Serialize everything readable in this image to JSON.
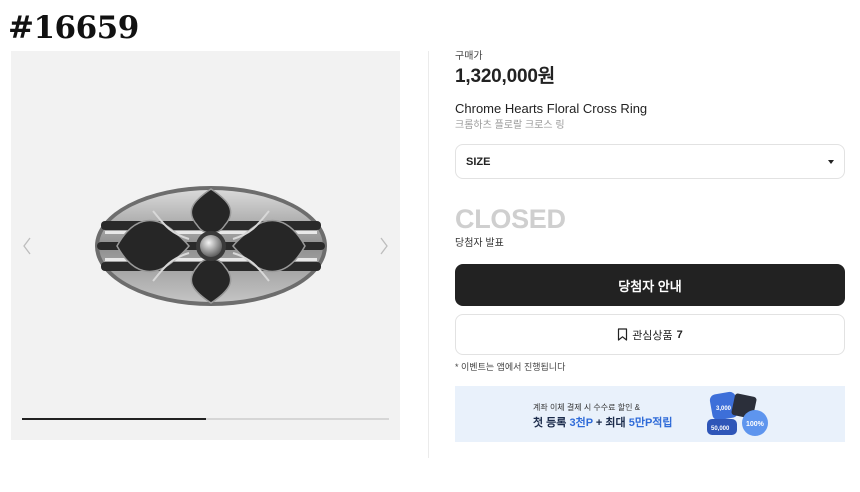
{
  "listing_tag": "#16659",
  "gallery": {
    "image_alt": "Chrome Hearts Floral Cross Ring",
    "progress_fraction": 0.5,
    "prev_icon": "chevron-left-icon",
    "next_icon": "chevron-right-icon"
  },
  "product": {
    "price_label": "구매가",
    "price": "1,320,000원",
    "name_en": "Chrome Hearts Floral Cross Ring",
    "name_ko": "크롬하츠 플로랄 크로스 링"
  },
  "size_select": {
    "label": "SIZE",
    "icon": "caret-down-icon"
  },
  "status": {
    "closed": "CLOSED",
    "announce": "당첨자 발표"
  },
  "buttons": {
    "winner_info": "당첨자 안내",
    "wishlist_label": "관심상품",
    "wishlist_count": "7",
    "wishlist_icon": "bookmark-icon"
  },
  "note": "* 이벤트는 앱에서 진행됩니다",
  "banner": {
    "line1": "계좌 이체 결제 시 수수료 할인 &",
    "line2_a": "첫 등록 ",
    "line2_b": "3천P",
    "line2_c": " + 최대 ",
    "line2_d": "5만P적립",
    "badge_1": "3,000",
    "badge_2": "50,000",
    "badge_3": "100%"
  },
  "colors": {
    "primary_button": "#222222",
    "banner_bg": "#e9f1fb",
    "highlight": "#2f6bd8",
    "closed_text": "#cfcfcf"
  }
}
